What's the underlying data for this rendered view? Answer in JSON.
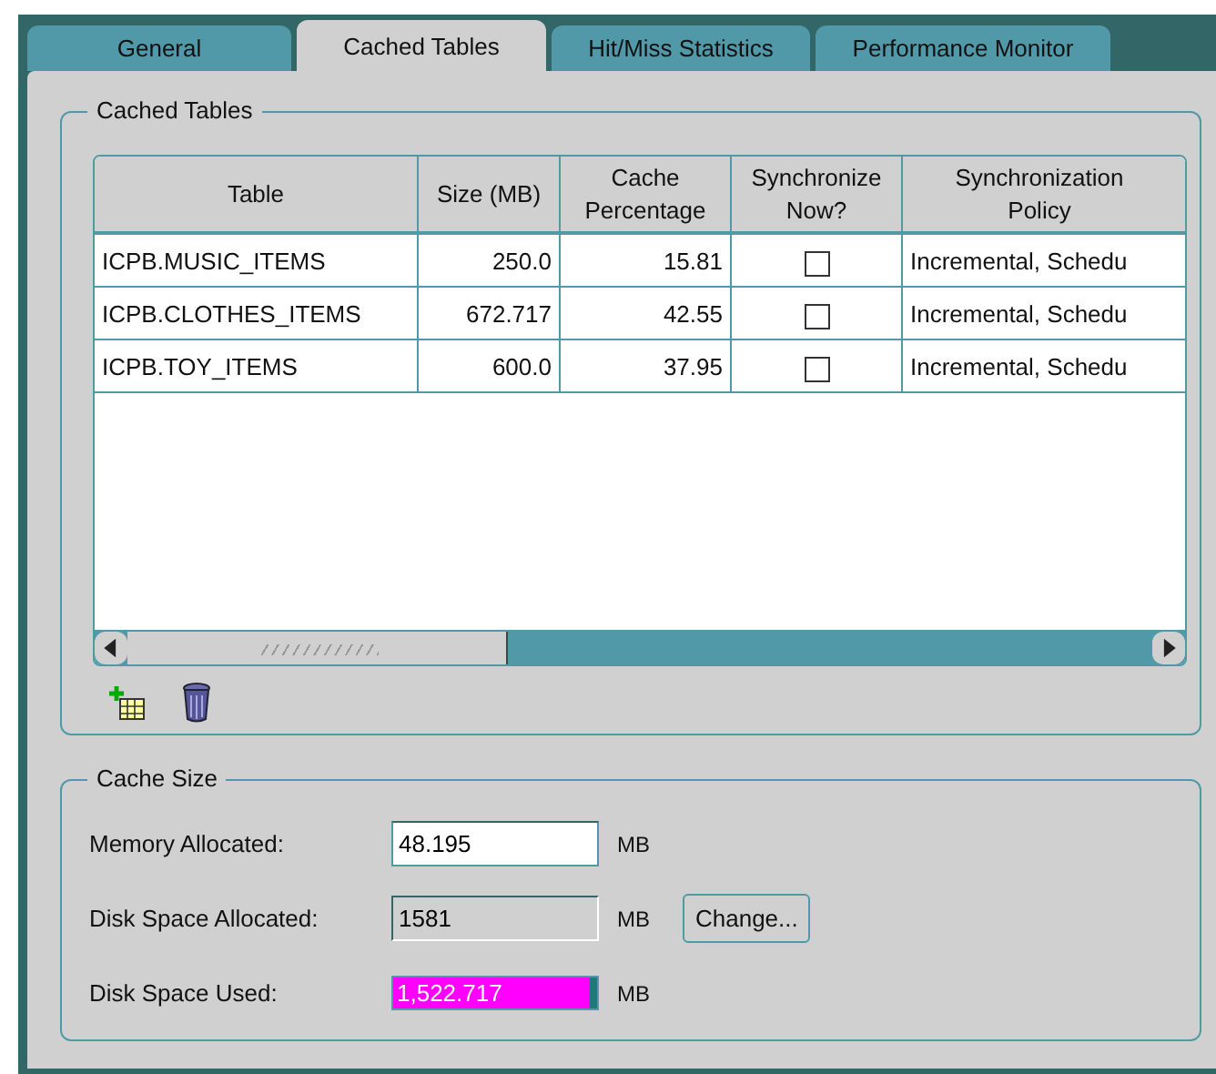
{
  "tabs": [
    {
      "label": "General",
      "selected": false
    },
    {
      "label": "Cached Tables",
      "selected": true
    },
    {
      "label": "Hit/Miss Statistics",
      "selected": false
    },
    {
      "label": "Performance Monitor",
      "selected": false
    }
  ],
  "cached_tables": {
    "title": "Cached Tables",
    "columns": [
      {
        "line1": "Table"
      },
      {
        "line1": "Size (MB)"
      },
      {
        "line1": "Cache",
        "line2": "Percentage"
      },
      {
        "line1": "Synchronize",
        "line2": "Now?"
      },
      {
        "line1": "Synchronization",
        "line2": "Policy"
      }
    ],
    "rows": [
      {
        "table": "ICPB.MUSIC_ITEMS",
        "size": "250.0",
        "percentage": "15.81",
        "synchronize_now": false,
        "policy": "Incremental, Schedu"
      },
      {
        "table": "ICPB.CLOTHES_ITEMS",
        "size": "672.717",
        "percentage": "42.55",
        "synchronize_now": false,
        "policy": "Incremental, Schedu"
      },
      {
        "table": "ICPB.TOY_ITEMS",
        "size": "600.0",
        "percentage": "37.95",
        "synchronize_now": false,
        "policy": "Incremental, Schedu"
      }
    ]
  },
  "cache_size": {
    "title": "Cache Size",
    "memory_allocated": {
      "label": "Memory Allocated:",
      "value": "48.195",
      "unit": "MB"
    },
    "disk_space_allocated": {
      "label": "Disk Space Allocated:",
      "value": "1581",
      "unit": "MB",
      "button": "Change..."
    },
    "disk_space_used": {
      "label": "Disk Space Used:",
      "value": "1,522.717",
      "unit": "MB",
      "level": 0.96
    }
  }
}
